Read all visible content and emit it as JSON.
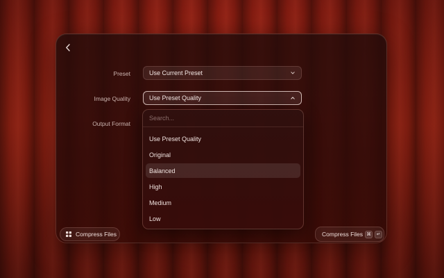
{
  "window": {
    "back_icon": "chevron-left-icon"
  },
  "form": {
    "preset": {
      "label": "Preset",
      "value": "Use Current Preset"
    },
    "image_quality": {
      "label": "Image Quality",
      "value": "Use Preset Quality"
    },
    "output_format": {
      "label": "Output Format"
    }
  },
  "dropdown": {
    "search_placeholder": "Search...",
    "options": [
      {
        "label": "Use Preset Quality"
      },
      {
        "label": "Original"
      },
      {
        "label": "Balanced",
        "highlighted": true
      },
      {
        "label": "High"
      },
      {
        "label": "Medium"
      },
      {
        "label": "Low"
      }
    ]
  },
  "footer": {
    "left_button": {
      "label": "Compress Files",
      "icon": "grid-icon"
    },
    "right_button": {
      "label": "Compress Files",
      "shortcut": [
        "⌘",
        "↵"
      ]
    }
  },
  "colors": {
    "curtain": "#9e2414",
    "panel": "#2a0c0a",
    "text": "#f2e6e3"
  }
}
